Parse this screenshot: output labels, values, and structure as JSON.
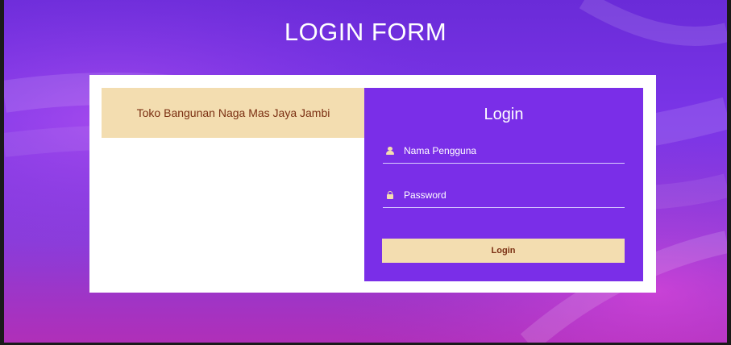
{
  "page": {
    "title": "LOGIN FORM"
  },
  "banner": {
    "text": "Toko Bangunan Naga Mas Jaya Jambi"
  },
  "login_panel": {
    "title": "Login",
    "username_field": {
      "placeholder": "Nama Pengguna",
      "value": "",
      "icon": "user-icon"
    },
    "password_field": {
      "placeholder": "Password",
      "value": "",
      "icon": "lock-icon"
    },
    "submit_label": "Login"
  },
  "colors": {
    "background_purple": "#7b35e8",
    "background_magenta": "#b02fb8",
    "panel_purple": "#7a2ee8",
    "cream": "#f3ddb0",
    "brown_text": "#7a2f12",
    "card_white": "#ffffff"
  }
}
